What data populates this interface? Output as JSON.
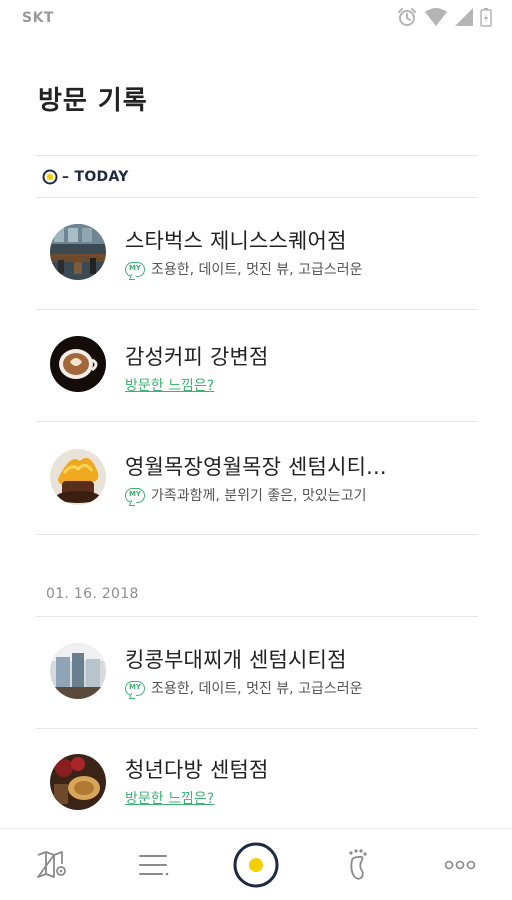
{
  "status_bar": {
    "carrier": "SKT",
    "icons": [
      "alarm-icon",
      "wifi-icon",
      "signal-icon",
      "battery-icon"
    ]
  },
  "page": {
    "title": "방문 기록"
  },
  "sections": [
    {
      "label": "– TODAY",
      "items": [
        {
          "title": "스타벅스 제니스스퀘어점",
          "badge": "MY",
          "tags": "조용한, 데이트, 멋진 뷰, 고급스러운"
        },
        {
          "title": "감성커피 강변점",
          "link": "방문한 느낌은?"
        },
        {
          "title": "영월목장영월목장  센텀시티...",
          "badge": "MY",
          "tags": "가족과함께, 분위기 좋은, 맛있는고기"
        }
      ]
    },
    {
      "label": "01. 16. 2018",
      "items": [
        {
          "title": "킹콩부대찌개 센텀시티점",
          "badge": "MY",
          "tags": "조용한, 데이트, 멋진 뷰, 고급스러운"
        },
        {
          "title": "청년다방 센텀점",
          "link": "방문한 느낌은?"
        }
      ]
    }
  ],
  "bottom_nav": [
    "map-icon",
    "menu-icon",
    "record-icon",
    "footprint-icon",
    "more-icon"
  ],
  "colors": {
    "accent_green": "#3cb371",
    "navy": "#1f2a44",
    "yellow": "#f5d000"
  }
}
